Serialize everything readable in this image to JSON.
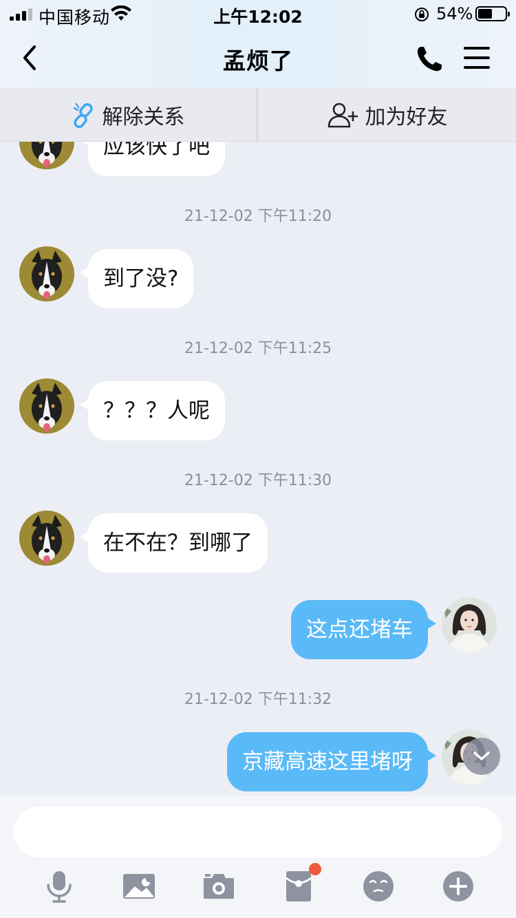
{
  "status_bar": {
    "carrier": "中国移动",
    "time": "上午12:02",
    "battery_percent": "54%",
    "battery_level": 0.54
  },
  "nav": {
    "title": "孟烦了",
    "icons": [
      "back-arrow-icon",
      "phone-icon",
      "menu-icon"
    ]
  },
  "actions": {
    "unlink_label": "解除关系",
    "add_friend_label": "加为好友"
  },
  "messages": [
    {
      "type": "incoming",
      "text": "应该快了吧"
    },
    {
      "type": "timestamp",
      "text": "21-12-02 下午11:20"
    },
    {
      "type": "incoming",
      "text": "到了没?"
    },
    {
      "type": "timestamp",
      "text": "21-12-02 下午11:25"
    },
    {
      "type": "incoming",
      "text": "？？？人呢"
    },
    {
      "type": "timestamp",
      "text": "21-12-02 下午11:30"
    },
    {
      "type": "incoming",
      "text": "在不在？到哪了"
    },
    {
      "type": "outgoing",
      "text": "这点还堵车"
    },
    {
      "type": "timestamp",
      "text": "21-12-02 下午11:32"
    },
    {
      "type": "outgoing",
      "text": "京藏高速这里堵呀"
    }
  ],
  "input": {
    "placeholder": "",
    "value": ""
  },
  "toolbar": {
    "items": [
      "microphone-icon",
      "image-icon",
      "camera-icon",
      "red-packet-icon",
      "emoji-icon",
      "plus-icon"
    ],
    "badge_color": "#f05a3c"
  },
  "colors": {
    "outgoing_bubble": "#5ab9f7",
    "incoming_bubble": "#ffffff",
    "background": "#eceef5"
  }
}
